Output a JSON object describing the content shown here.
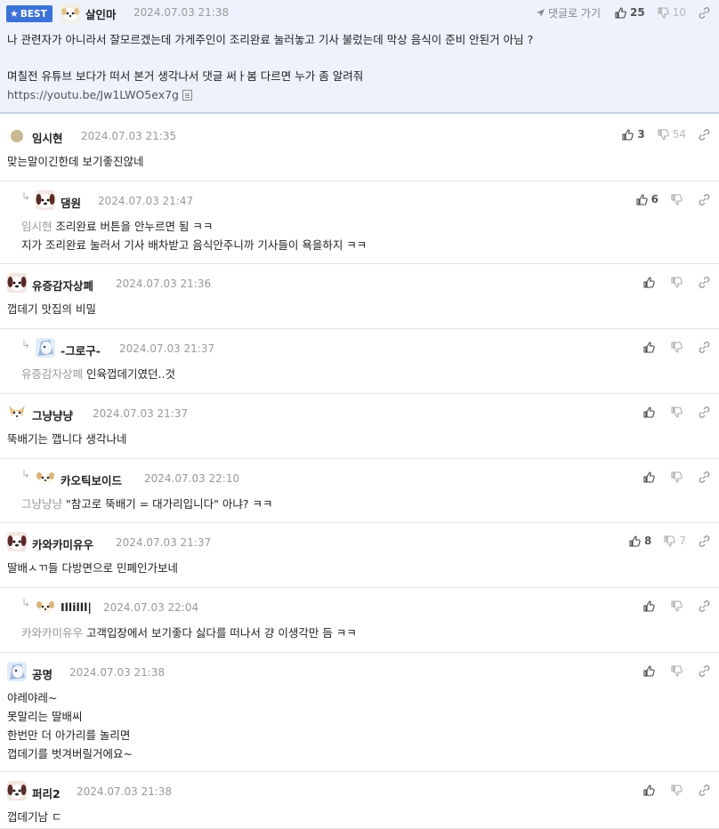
{
  "best": {
    "badge": "BEST",
    "nick": "살인마",
    "time": "2024.07.03 21:38",
    "goto": "댓글로 가기",
    "up": "25",
    "down": "10",
    "lines": [
      "나 관련자가 아니라서 잘모르겠는데 가게주인이 조리완료 눌러놓고 기사 불렀는데 막상 음식이 준비 안된거 아님 ?",
      "",
      "며칠전 유튜브 보다가 떠서 본거 생각나서 댓글 써ㅏ봄 다르면 누가 좀 알려줘"
    ],
    "url": "https://youtu.be/Jw1LWO5ex7g"
  },
  "comments": [
    {
      "nick": "임시현",
      "time": "2024.07.03 21:35",
      "up": "3",
      "down": "54",
      "mention": "",
      "lines": [
        "맞는말이긴한데 보기좋진않네"
      ],
      "reply": false,
      "avatar": "circle"
    },
    {
      "nick": "댐원",
      "time": "2024.07.03 21:47",
      "up": "6",
      "down": "",
      "mention": "임시현",
      "lines": [
        "조리완료 버튼을 안누르면 됨 ㅋㅋ",
        "지가 조리완료 눌러서 기사 배차받고 음식안주니까 기사들이 욕을하지 ㅋㅋ"
      ],
      "reply": true,
      "avatar": "dog"
    },
    {
      "nick": "유증감자상폐",
      "time": "2024.07.03 21:36",
      "up": "",
      "down": "",
      "mention": "",
      "lines": [
        "껍데기 맛집의 비밀"
      ],
      "reply": false,
      "avatar": "dog"
    },
    {
      "nick": "-그로구-",
      "time": "2024.07.03 21:37",
      "up": "",
      "down": "",
      "mention": "유증감자상폐",
      "lines": [
        "인육껍데기였던..것"
      ],
      "reply": true,
      "avatar": "blue"
    },
    {
      "nick": "그냥냥냥",
      "time": "2024.07.03 21:37",
      "up": "",
      "down": "",
      "mention": "",
      "lines": [
        "뚝배기는 깹니다 생각나네"
      ],
      "reply": false,
      "avatar": "fox"
    },
    {
      "nick": "카오틱보이드",
      "time": "2024.07.03 22:10",
      "up": "",
      "down": "",
      "mention": "그냥냥냥",
      "lines": [
        "\"참고로 뚝배기 = 대가리입니다\" 아냐? ㅋㅋ"
      ],
      "reply": true,
      "avatar": "puppy"
    },
    {
      "nick": "카와카미유우",
      "time": "2024.07.03 21:37",
      "up": "8",
      "down": "7",
      "mention": "",
      "lines": [
        "딸배ㅅㄲ들 다방면으로 민폐인가보네"
      ],
      "reply": false,
      "avatar": "dog"
    },
    {
      "nick": "Illilll|",
      "time": "2024.07.03 22:04",
      "up": "",
      "down": "",
      "mention": "카와카미유우",
      "lines": [
        "고객입장에서 보기좋다 싫다를 떠나서 걍 이생각만 듬 ㅋㅋ"
      ],
      "reply": true,
      "avatar": "puppy"
    },
    {
      "nick": "공명",
      "time": "2024.07.03 21:38",
      "up": "",
      "down": "",
      "mention": "",
      "lines": [
        "야레야레~",
        "못말리는 딸배씨",
        "한번만 더 아가리를 놀리면",
        "껍데기를 벗겨버릴거에요~"
      ],
      "reply": false,
      "avatar": "blue"
    },
    {
      "nick": "퍼리2",
      "time": "2024.07.03 21:38",
      "up": "",
      "down": "",
      "mention": "",
      "lines": [
        "껍데기남 ㄷ"
      ],
      "reply": false,
      "avatar": "dog"
    }
  ]
}
